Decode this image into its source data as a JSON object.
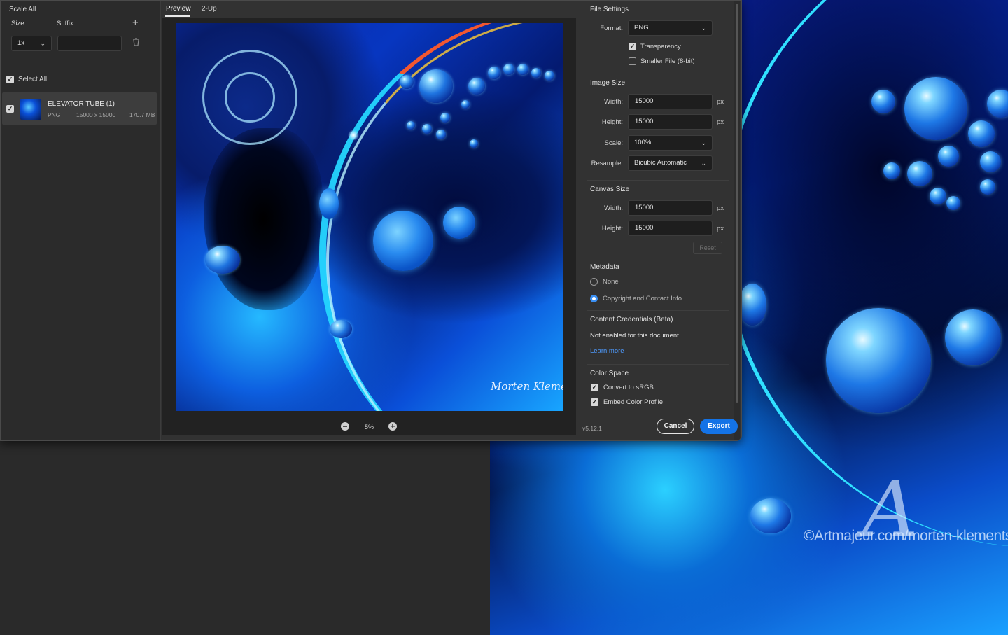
{
  "left_panel": {
    "scale_all": "Scale All",
    "size_label": "Size:",
    "suffix_label": "Suffix:",
    "size_value": "1x",
    "suffix_value": "",
    "select_all": "Select All",
    "asset": {
      "name": "ELEVATOR TUBE (1)",
      "format": "PNG",
      "dimensions": "15000 x 15000",
      "file_size": "170.7 MB"
    }
  },
  "tabs": [
    "Preview",
    "2-Up"
  ],
  "zoom": {
    "value": "5%"
  },
  "artwork": {
    "signature": "Morten Klementsen"
  },
  "file_settings": {
    "title": "File Settings",
    "format_label": "Format:",
    "format_value": "PNG",
    "transparency": "Transparency",
    "smaller_file": "Smaller File (8-bit)"
  },
  "image_size": {
    "title": "Image Size",
    "width_label": "Width:",
    "width_value": "15000",
    "height_label": "Height:",
    "height_value": "15000",
    "scale_label": "Scale:",
    "scale_value": "100%",
    "resample_label": "Resample:",
    "resample_value": "Bicubic Automatic",
    "unit": "px"
  },
  "canvas_size": {
    "title": "Canvas Size",
    "width_label": "Width:",
    "width_value": "15000",
    "height_label": "Height:",
    "height_value": "15000",
    "unit": "px",
    "reset": "Reset"
  },
  "metadata": {
    "title": "Metadata",
    "option_none": "None",
    "option_copyright": "Copyright and Contact Info"
  },
  "content_credentials": {
    "title": "Content Credentials (Beta)",
    "status": "Not enabled for this document",
    "learn_more": "Learn more"
  },
  "color_space": {
    "title": "Color Space",
    "convert": "Convert to sRGB",
    "embed": "Embed Color Profile"
  },
  "footer": {
    "version": "v5.12.1",
    "cancel": "Cancel",
    "export": "Export"
  },
  "watermark": {
    "logo": "A",
    "text": "©Artmajeur.com/morten-klementsen"
  },
  "colors": {
    "accent": "#1473e6",
    "panel": "#323232",
    "input": "#1e1e1e"
  }
}
